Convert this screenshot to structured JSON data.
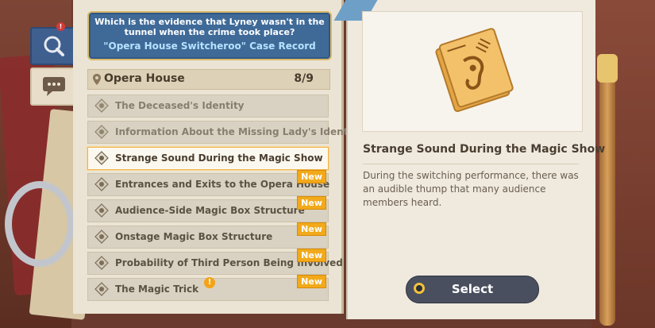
{
  "question": {
    "text": "Which is the evidence that Lyney wasn't in the tunnel when the crime took place?",
    "case_record": "\"Opera House Switcheroo\" Case Record"
  },
  "tabs": [
    {
      "icon": "magnifier-icon",
      "alert": "!"
    },
    {
      "icon": "chat-bubble-icon"
    }
  ],
  "location": {
    "name": "Opera House",
    "count": "8/9"
  },
  "evidence_list": [
    {
      "label": "The Deceased's Identity",
      "state": "faded",
      "new": ""
    },
    {
      "label": "Information About the Missing Lady's Identity",
      "state": "faded",
      "new": ""
    },
    {
      "label": "Strange Sound During the Magic Show",
      "state": "selected",
      "new": ""
    },
    {
      "label": "Entrances and Exits to the Opera House",
      "state": "normal",
      "new": "New"
    },
    {
      "label": "Audience-Side Magic Box Structure",
      "state": "normal",
      "new": "New"
    },
    {
      "label": "Onstage Magic Box Structure",
      "state": "normal",
      "new": "New"
    },
    {
      "label": "Probability of Third Person Being Involved",
      "state": "normal",
      "new": "New"
    },
    {
      "label": "The Magic Trick",
      "state": "normal",
      "new": "New"
    }
  ],
  "bottom_alert": "!",
  "detail": {
    "title": "Strange Sound During the Magic Show",
    "description": "During the switching performance, there was an audible thump that many audience members heard.",
    "image_icon": "ear-card-icon"
  },
  "select_button": {
    "label": "Select"
  },
  "colors": {
    "accent": "#f2a91a",
    "banner": "#3f6a98",
    "button": "#4a4f5f"
  }
}
